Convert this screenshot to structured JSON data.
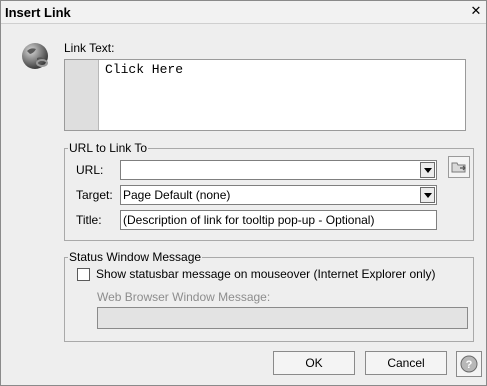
{
  "window": {
    "title": "Insert Link",
    "close_glyph": "✕"
  },
  "link_text": {
    "label": "Link Text:",
    "value": "Click Here"
  },
  "url_group": {
    "legend": "URL to Link To",
    "url_label": "URL:",
    "url_value": "",
    "target_label": "Target:",
    "target_value": "Page Default (none)",
    "title_label": "Title:",
    "title_value": "(Description of link for tooltip pop-up - Optional)"
  },
  "status_group": {
    "legend": "Status Window Message",
    "checkbox_label": "Show statusbar message on mouseover (Internet Explorer only)",
    "checkbox_checked": false,
    "message_label": "Web Browser Window Message:",
    "message_value": ""
  },
  "buttons": {
    "ok": "OK",
    "cancel": "Cancel"
  },
  "icons": {
    "globe": "globe-icon",
    "browse": "folder-browse-icon",
    "help": "help-icon",
    "dropdown": "chevron-down-icon"
  }
}
